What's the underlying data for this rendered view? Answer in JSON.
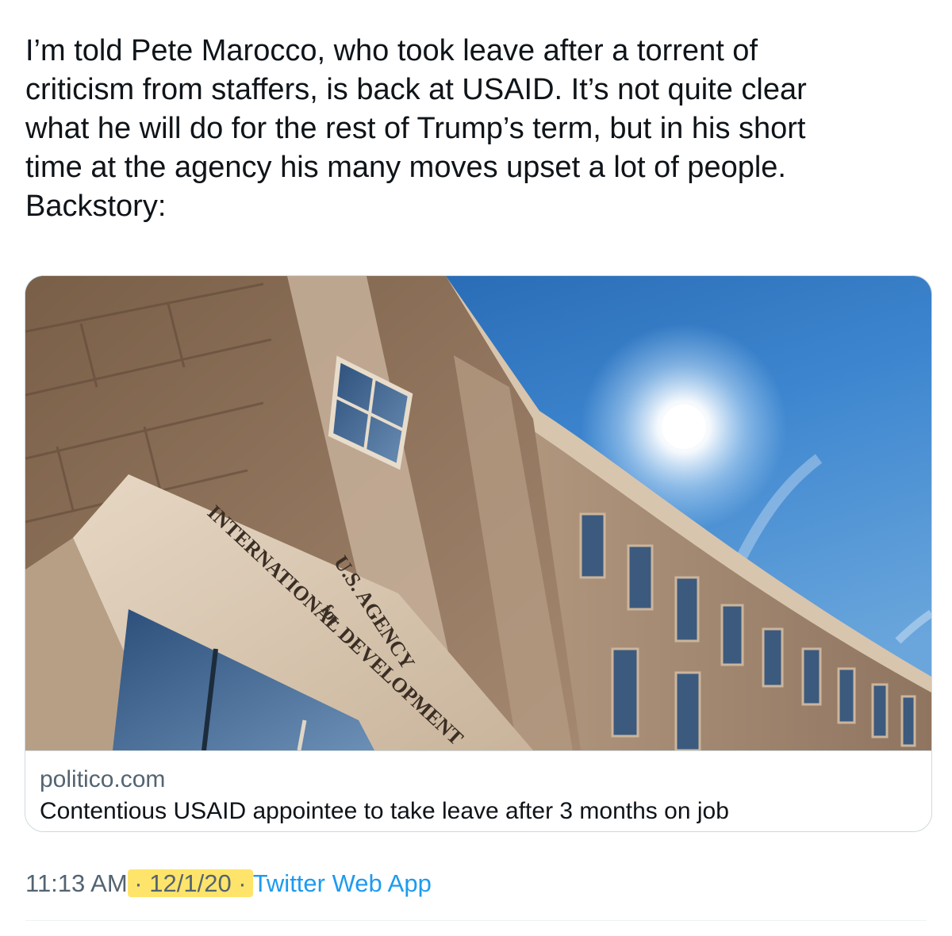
{
  "tweet": {
    "text_lines": [
      "I’m told Pete Marocco, who took leave after a torrent of",
      "criticism from staffers, is back at USAID. It’s not quite clear",
      "what he will do for the rest of Trump’s term, but in his short",
      "time at the agency his many moves upset a lot of people.",
      "Backstory:"
    ]
  },
  "link_card": {
    "domain": "politico.com",
    "title": "Contentious USAID appointee to take leave after 3 months on job",
    "image_inscription": {
      "line1": "U.S. AGENCY",
      "line2": "for",
      "line3": "INTERNATIONAL DEVELOPMENT"
    }
  },
  "footer": {
    "time": "11:13 AM",
    "separator1": " · ",
    "date": "12/1/20",
    "separator2": " · ",
    "source": "Twitter Web App"
  },
  "colors": {
    "text_primary": "#0f1419",
    "text_secondary": "#536471",
    "link": "#1d9bf0",
    "highlight": "#ffe46b",
    "sky": "#3d7fc9",
    "stone": "#a38a72"
  }
}
